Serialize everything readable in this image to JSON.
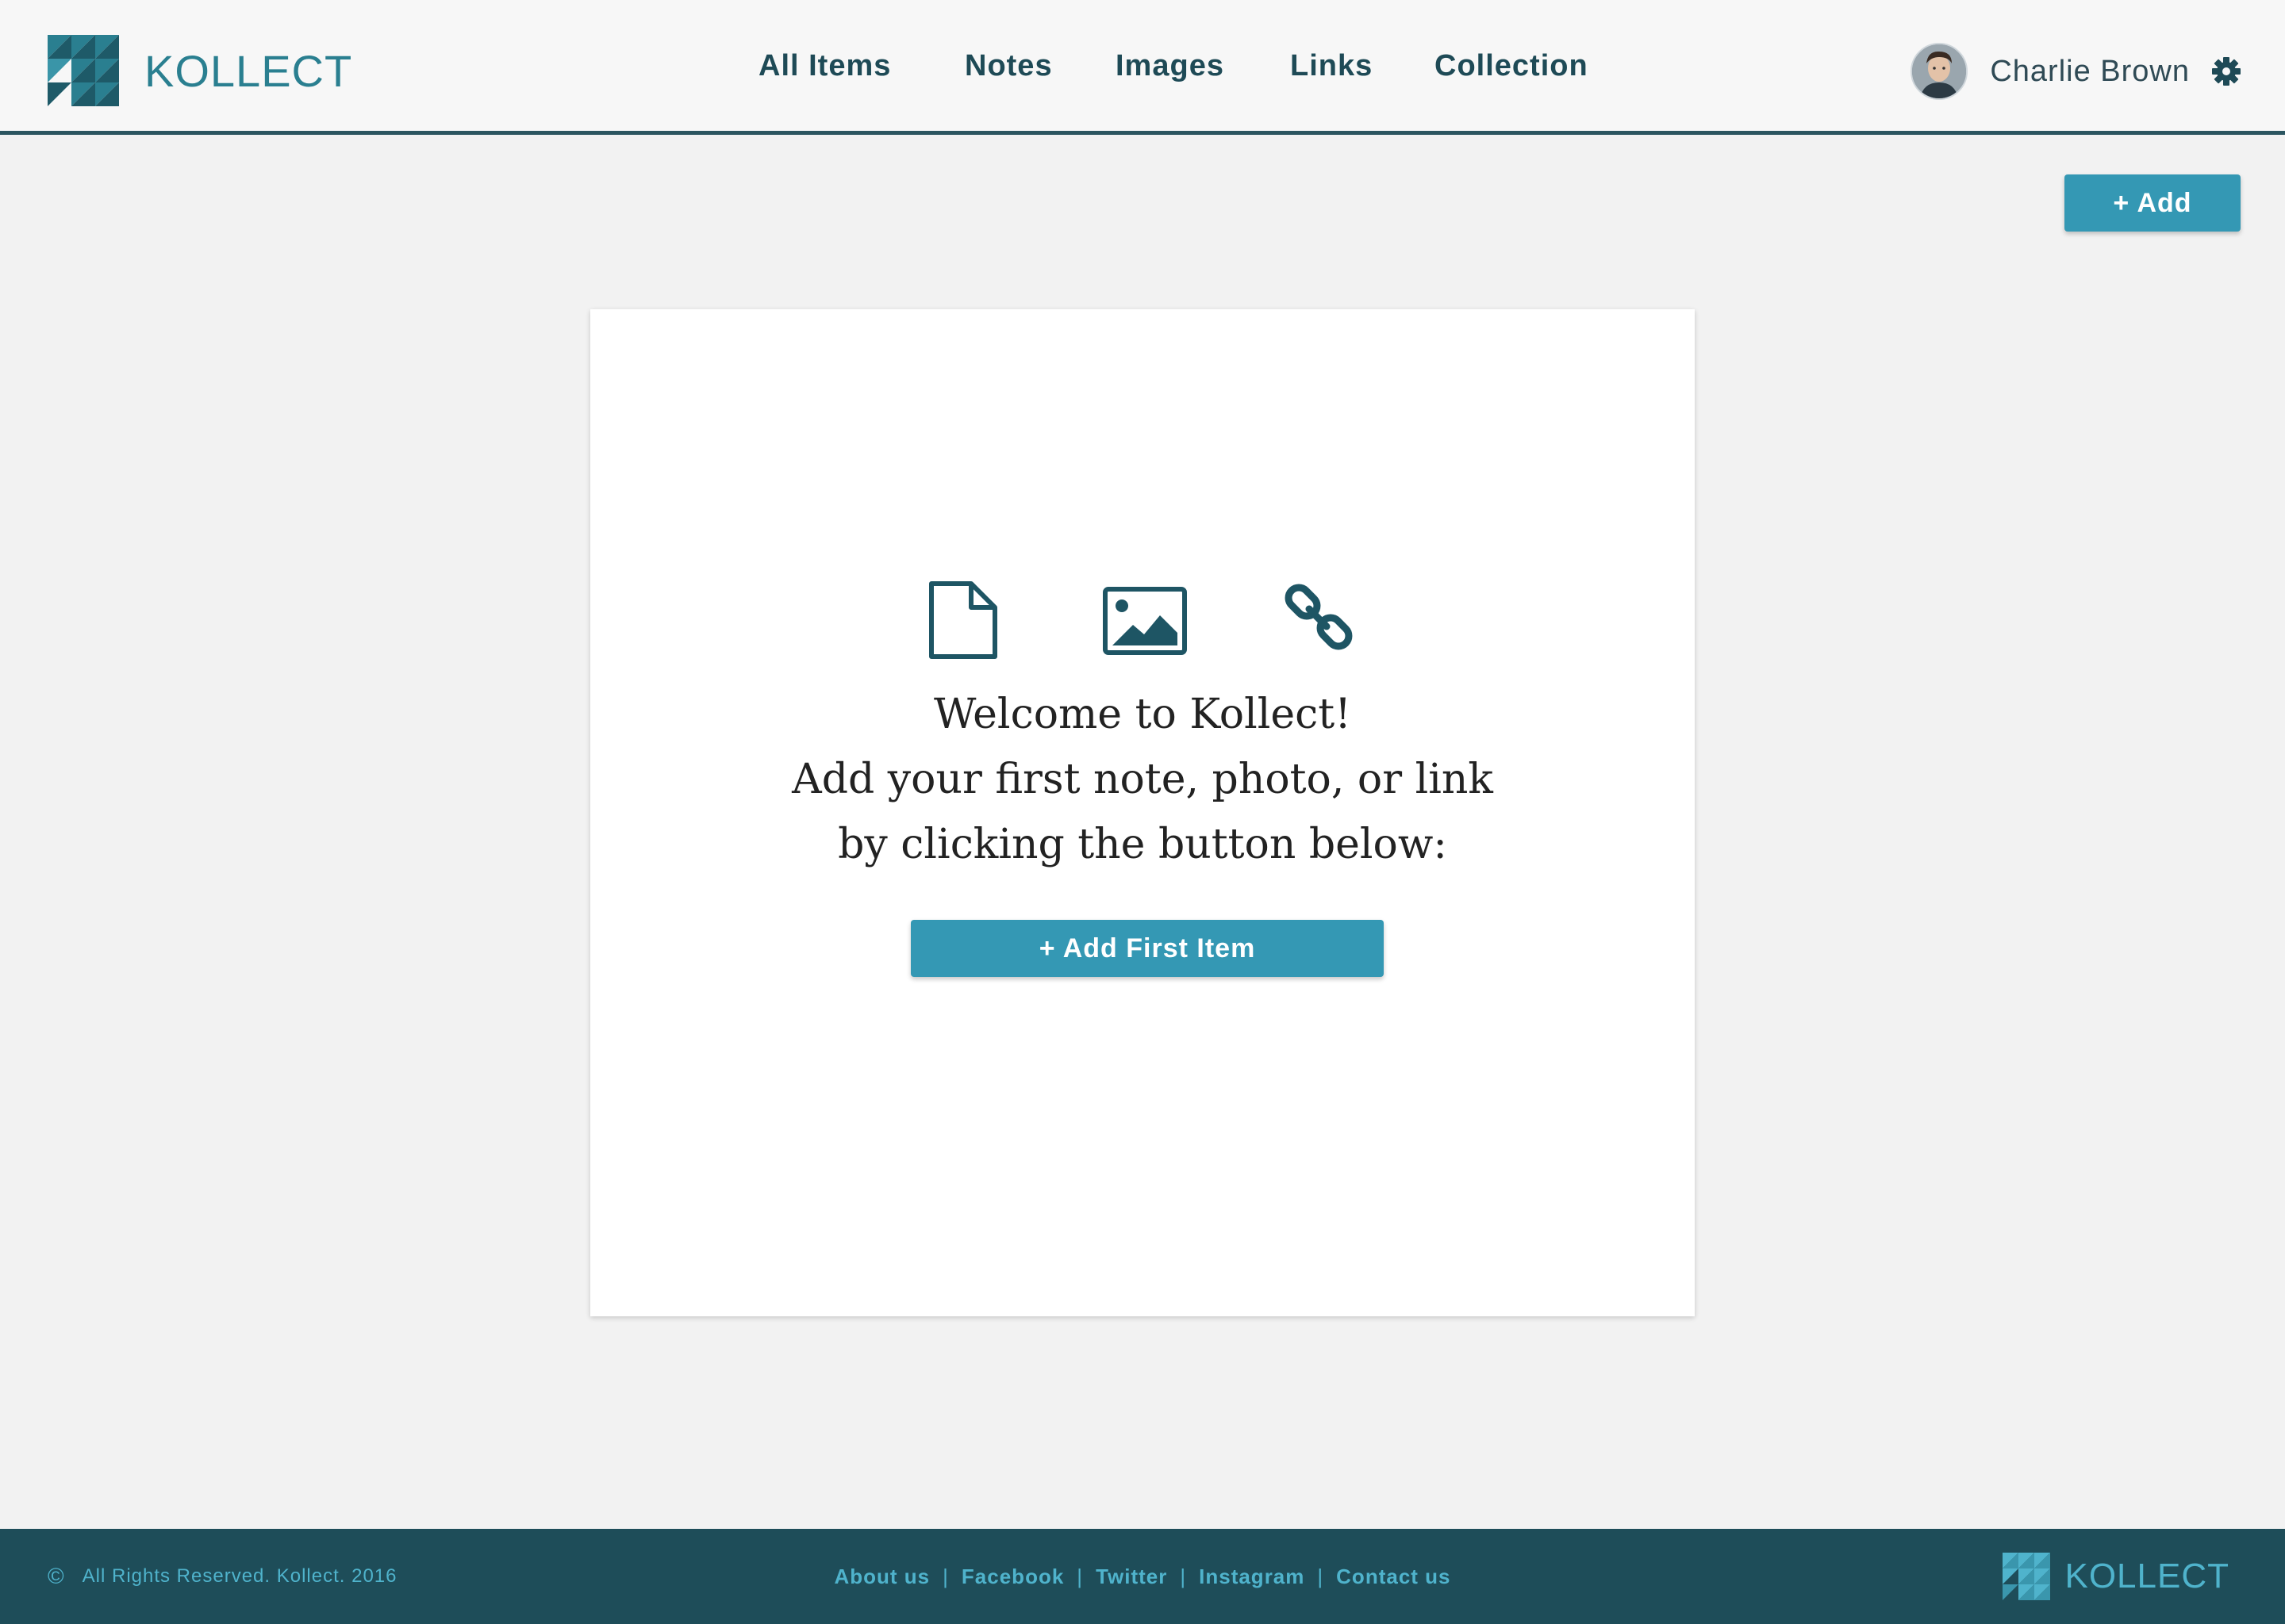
{
  "brand": {
    "name": "KOLLECT"
  },
  "nav": {
    "items": [
      {
        "label": "All Items"
      },
      {
        "label": "Notes"
      },
      {
        "label": "Images"
      },
      {
        "label": "Links"
      },
      {
        "label": "Collection"
      }
    ]
  },
  "user": {
    "name": "Charlie Brown"
  },
  "toolbar": {
    "add_label": "+ Add"
  },
  "empty_state": {
    "line1": "Welcome to Kollect!",
    "line2": "Add your first note, photo, or link",
    "line3": "by clicking the button below:",
    "button_label": "+ Add First Item",
    "icons": [
      "note-icon",
      "image-icon",
      "link-icon"
    ]
  },
  "footer": {
    "copyright_symbol": "©",
    "copyright": "All Rights Reserved.  Kollect. 2016",
    "links": [
      "About us",
      "Facebook",
      "Twitter",
      "Instagram",
      "Contact us"
    ],
    "separator": "|",
    "brand_name": "KOLLECT"
  },
  "colors": {
    "accent": "#3498b4",
    "dark_teal": "#1e4d59",
    "nav_text": "#1e4a56",
    "brand_text": "#2a7f90",
    "footer_link": "#4fb3cc"
  }
}
